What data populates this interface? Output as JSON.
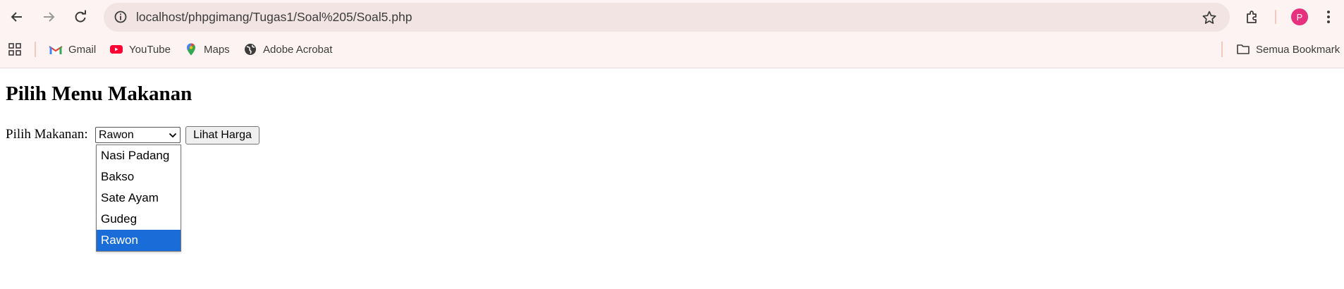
{
  "browser": {
    "url": "localhost/phpgimang/Tugas1/Soal%205/Soal5.php",
    "profile_initial": "P",
    "bookmarks": [
      {
        "label": "Gmail",
        "icon": "gmail-icon"
      },
      {
        "label": "YouTube",
        "icon": "youtube-icon"
      },
      {
        "label": "Maps",
        "icon": "maps-icon"
      },
      {
        "label": "Adobe Acrobat",
        "icon": "globe-icon"
      }
    ],
    "all_bookmarks_label": "Semua Bookmark",
    "colors": {
      "accent": "#1a6dd8",
      "avatar": "#e8317e",
      "chrome_bg": "#fdf3f2",
      "omnibox_bg": "#f1e4e3"
    }
  },
  "page": {
    "title": "Pilih Menu Makanan",
    "form": {
      "label": "Pilih Makanan:",
      "selected": "Rawon",
      "options": [
        "Nasi Padang",
        "Bakso",
        "Sate Ayam",
        "Gudeg",
        "Rawon"
      ],
      "submit_label": "Lihat Harga"
    }
  }
}
